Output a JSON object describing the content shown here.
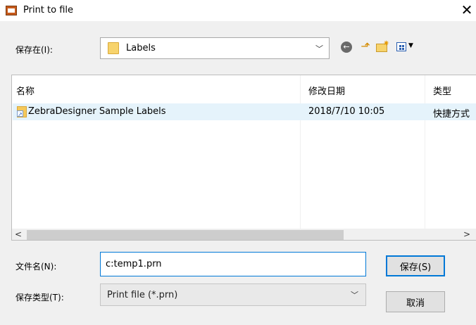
{
  "window": {
    "title": "Print to file",
    "close_glyph": "✕"
  },
  "toolbar": {
    "save_in_label": "保存在(I):",
    "location_value": "Labels",
    "icons": [
      "back-icon",
      "up-folder-icon",
      "new-folder-icon",
      "view-menu-icon"
    ]
  },
  "file_list": {
    "columns": [
      "名称",
      "修改日期",
      "类型"
    ],
    "sort_column": "名称",
    "rows": [
      {
        "name": "ZebraDesigner Sample Labels",
        "modified": "2018/7/10 10:05",
        "type": "快捷方式"
      }
    ]
  },
  "form": {
    "filename_label": "文件名(N):",
    "filename_value": "c:temp1.prn",
    "filetype_label": "保存类型(T):",
    "filetype_value": "Print file (*.prn)"
  },
  "buttons": {
    "save": "保存(S)",
    "cancel": "取消"
  },
  "colors": {
    "accent": "#0078d7",
    "selection": "#e5f3fb",
    "folder": "#f7d36c"
  }
}
